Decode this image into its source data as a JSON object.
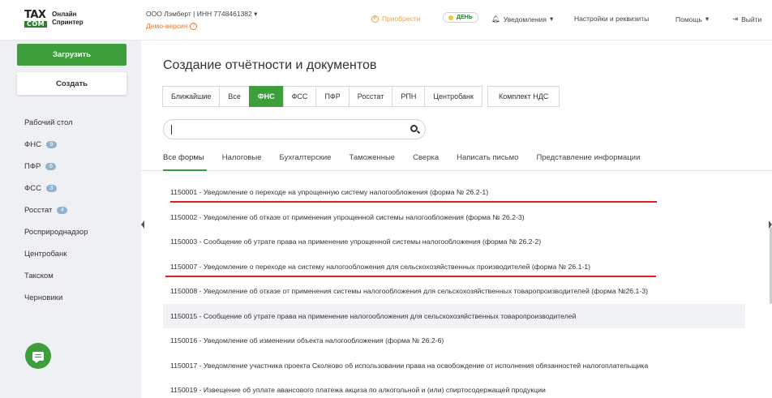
{
  "header": {
    "logo_tax": "TAX",
    "logo_com": "COM",
    "logo_line1": "Онлайн",
    "logo_line2": "Спринтер",
    "org": "ООО Лэмберт | ИНН 7748461382",
    "demo": "Демо-версия",
    "buy": "Приобрести",
    "day": "ДЕНЬ",
    "notifications": "Уведомления",
    "settings": "Настройки и реквизиты",
    "help": "Помощь",
    "exit": "Выйти"
  },
  "sidebar": {
    "upload": "Загрузить",
    "create": "Создать",
    "items": [
      {
        "label": "Рабочий стол",
        "badge": null
      },
      {
        "label": "ФНС",
        "badge": "9"
      },
      {
        "label": "ПФР",
        "badge": "6"
      },
      {
        "label": "ФСС",
        "badge": "3"
      },
      {
        "label": "Росстат",
        "badge": "4"
      },
      {
        "label": "Росприроднадзор",
        "badge": null
      },
      {
        "label": "Центробанк",
        "badge": null
      },
      {
        "label": "Такском",
        "badge": null
      },
      {
        "label": "Черновики",
        "badge": null
      }
    ]
  },
  "main": {
    "title": "Создание отчётности и документов",
    "tabs": [
      "Ближайшие",
      "Все",
      "ФНС",
      "ФСС",
      "ПФР",
      "Росстат",
      "РПН",
      "Центробанк"
    ],
    "active_tab": "ФНС",
    "nds_tab": "Комплект НДС",
    "search_value": "",
    "subtabs": [
      "Все формы",
      "Налоговые",
      "Бухгалтерские",
      "Таможенные",
      "Сверка",
      "Написать письмо",
      "Представление информации"
    ],
    "active_subtab": "Все формы",
    "forms": [
      "1150001 - Уведомление о переходе на упрощенную систему налогообложения (форма № 26.2-1)",
      "1150002 - Уведомление об отказе от применения упрощенной системы налогообложения (форма № 26.2-3)",
      "1150003 - Сообщение об утрате права на применение упрощенной системы налогообложения (форма № 26.2-2)",
      "1150007 - Уведомление о переходе на систему налогообложения для сельскохозяйственных производителей (форма № 26.1-1)",
      "1150008 - Уведомление об отказе от применения системы налогообложения для сельскохозяйственных товаропроизводителей (форма №26.1-3)",
      "1150015 - Сообщение об утрате права на применение налогообложения для сельскохозяйственных товаропроизводителей",
      "1150016 - Уведомление об изменении объекта налогообложения (форма № 26.2-6)",
      "1150017 - Уведомление участника проекта Сколково об использовании права на освобождение от исполнения обязанностей налогоплательщика",
      "1150019 - Извещение об уплате авансового платежа акциза по алкогольной и (или) спиртосодержащей продукции"
    ]
  },
  "colors": {
    "accent": "#3f9e3c",
    "badge": "#8fb3cf",
    "demo": "#e8772e",
    "underline": "#e02020"
  }
}
